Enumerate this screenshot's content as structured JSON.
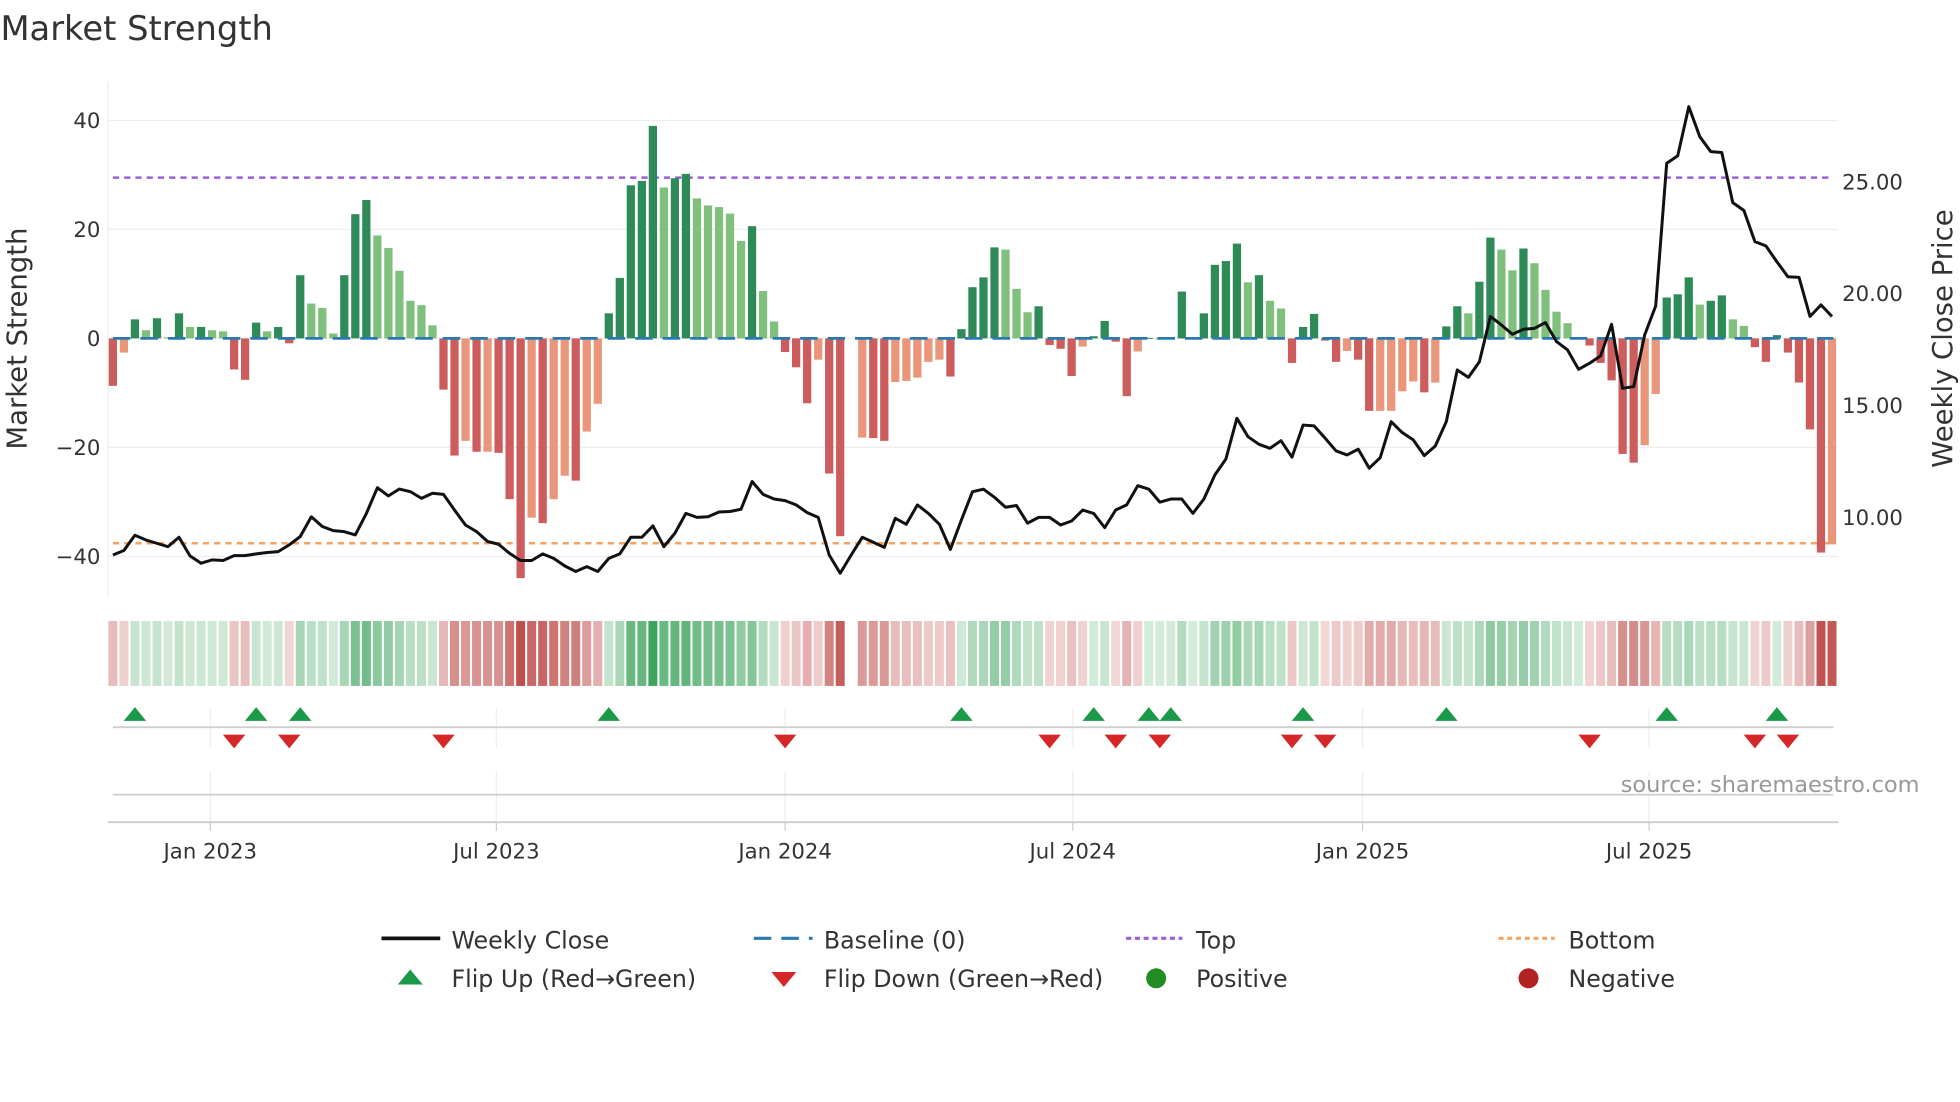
{
  "chart_data": {
    "type": "bar",
    "title": "Market Strength",
    "ylabel_left": "Market Strength",
    "ylabel_right": "Weekly Close Price",
    "ylim_left": [
      -47.5,
      47.2
    ],
    "ylim_right": [
      6.37,
      29.44
    ],
    "yticks_left": [
      {
        "v": 40,
        "label": "40"
      },
      {
        "v": 20,
        "label": "20"
      },
      {
        "v": 0,
        "label": "0"
      },
      {
        "v": -20,
        "label": "−20"
      },
      {
        "v": -40,
        "label": "−40"
      }
    ],
    "yticks_right": [
      {
        "v": 25,
        "label": "25.00"
      },
      {
        "v": 20,
        "label": "20.00"
      },
      {
        "v": 15,
        "label": "15.00"
      },
      {
        "v": 10,
        "label": "10.00"
      }
    ],
    "xticks": [
      {
        "week": 8.84,
        "label": "Jan 2023"
      },
      {
        "week": 34.8,
        "label": "Jul 2023"
      },
      {
        "week": 61.0,
        "label": "Jan 2024"
      },
      {
        "week": 87.1,
        "label": "Jul 2024"
      },
      {
        "week": 113.4,
        "label": "Jan 2025"
      },
      {
        "week": 139.4,
        "label": "Jul 2025"
      }
    ],
    "grid": true,
    "top_level": 29.5,
    "bottom_level": -37.6,
    "baseline": 0,
    "strength": [
      -8.7,
      -2.6,
      3.5,
      1.5,
      3.7,
      0.2,
      4.6,
      2.1,
      2.1,
      1.5,
      1.3,
      -5.7,
      -7.6,
      2.9,
      1.3,
      2.1,
      -0.9,
      11.6,
      6.4,
      5.6,
      0.9,
      11.6,
      22.8,
      25.4,
      18.9,
      16.6,
      12.4,
      6.9,
      6.1,
      2.4,
      -9.4,
      -21.5,
      -18.8,
      -20.8,
      -20.8,
      -21,
      -29.5,
      -44,
      -32.9,
      -33.9,
      -29.5,
      -25.2,
      -26.1,
      -17.1,
      -12,
      4.6,
      11.1,
      28.1,
      28.9,
      39,
      27.7,
      29.4,
      30.2,
      25.7,
      24.4,
      24.1,
      22.9,
      17.9,
      20.6,
      8.7,
      3.1,
      -2.5,
      -5.3,
      -11.9,
      -3.9,
      -24.8,
      -36.3,
      null,
      -18.2,
      -18.3,
      -18.8,
      -8,
      -7.8,
      -7.2,
      -4.3,
      -3.9,
      -7,
      1.7,
      9.4,
      11.2,
      16.7,
      16.3,
      9.1,
      4.8,
      5.9,
      -1.2,
      -1.9,
      -6.9,
      -1.5,
      0.4,
      3.2,
      -0.6,
      -10.6,
      -2.4,
      0.1,
      0,
      0.2,
      8.6,
      0,
      4.6,
      13.5,
      14.2,
      17.4,
      10.3,
      11.6,
      6.9,
      5.5,
      -4.5,
      2.1,
      4.5,
      -0.4,
      -4.3,
      -2.3,
      -3.9,
      -13.3,
      -13.3,
      -13.3,
      -9.7,
      -7.9,
      -9.9,
      -8.1,
      2.2,
      5.9,
      4.6,
      10.4,
      18.5,
      16.3,
      12.5,
      16.5,
      13.8,
      8.9,
      4.9,
      2.8,
      0.1,
      -1.3,
      -4.5,
      -7.7,
      -21.2,
      -22.8,
      -19.6,
      -10.2,
      7.5,
      8.1,
      11.2,
      6.2,
      6.9,
      7.9,
      3.5,
      2.3,
      -1.6,
      -4.3,
      0.6,
      -2.6,
      -8.1,
      -16.7,
      -39.3,
      -37.8
    ],
    "weekly_close": [
      8.26,
      8.46,
      9.14,
      8.93,
      8.78,
      8.63,
      9.05,
      8.22,
      7.89,
      8.04,
      8.01,
      8.23,
      8.23,
      8.31,
      8.37,
      8.41,
      8.71,
      9.08,
      9.97,
      9.53,
      9.35,
      9.3,
      9.16,
      10.12,
      11.27,
      10.9,
      11.21,
      11.09,
      10.79,
      11.02,
      10.97,
      10.27,
      9.6,
      9.3,
      8.86,
      8.74,
      8.33,
      8.01,
      8.01,
      8.31,
      8.11,
      7.77,
      7.52,
      7.74,
      7.52,
      8.11,
      8.31,
      9.05,
      9.05,
      9.56,
      8.63,
      9.23,
      10.12,
      9.94,
      9.97,
      10.18,
      10.2,
      10.3,
      11.54,
      10.97,
      10.76,
      10.69,
      10.5,
      10.15,
      9.94,
      8.26,
      7.44,
      8.26,
      9.05,
      8.83,
      8.6,
      9.9,
      9.63,
      10.5,
      10.12,
      9.63,
      8.51,
      9.82,
      11.09,
      11.2,
      10.84,
      10.39,
      10.47,
      9.68,
      9.94,
      9.94,
      9.6,
      9.78,
      10.27,
      10.12,
      9.48,
      10.27,
      10.5,
      11.36,
      11.2,
      10.62,
      10.76,
      10.76,
      10.12,
      10.76,
      11.84,
      12.55,
      14.37,
      13.55,
      13.21,
      13.03,
      13.37,
      12.63,
      14.07,
      14.03,
      13.48,
      12.91,
      12.73,
      12.99,
      12.14,
      12.61,
      14.22,
      13.73,
      13.4,
      12.7,
      13.13,
      14.22,
      16.53,
      16.2,
      16.9,
      18.92,
      18.54,
      18.13,
      18.35,
      18.39,
      18.65,
      17.8,
      17.43,
      16.56,
      16.83,
      17.16,
      18.57,
      15.71,
      15.79,
      18.1,
      19.39,
      25.77,
      26.1,
      28.3,
      26.96,
      26.29,
      26.25,
      24.01,
      23.66,
      22.27,
      22.08,
      21.37,
      20.7,
      20.67,
      18.92,
      19.44,
      18.92
    ],
    "flip_up_weeks": [
      2,
      13,
      17,
      45,
      77,
      89,
      94,
      96,
      108,
      121,
      141,
      151
    ],
    "flip_down_weeks": [
      11,
      16,
      30,
      61,
      85,
      91,
      95,
      107,
      110,
      134,
      149,
      152
    ],
    "legend": {
      "placement": "bottom",
      "items": [
        {
          "key": "close",
          "label": "Weekly Close"
        },
        {
          "key": "baseline",
          "label": "Baseline (0)"
        },
        {
          "key": "top",
          "label": "Top"
        },
        {
          "key": "bottom",
          "label": "Bottom"
        },
        {
          "key": "flipup",
          "label": "Flip Up (Red→Green)"
        },
        {
          "key": "flipdown",
          "label": "Flip Down (Green→Red)"
        },
        {
          "key": "positive",
          "label": "Positive"
        },
        {
          "key": "negative",
          "label": "Negative"
        }
      ]
    },
    "annotation": "source: sharemaestro.com",
    "colors": {
      "pos_rising": "#2e8b57",
      "pos_falling": "#80c07d",
      "neg_falling": "#cd5c5c",
      "neg_rising": "#e9967a",
      "close": "#111111",
      "baseline": "#2a7ab0",
      "top": "#9b5fd6",
      "bottom": "#f4a460",
      "flipup": "#1a9a48",
      "flipdown": "#d62728",
      "positive": "#228b22",
      "negative": "#b22222",
      "strip_pos": "#3aa35a",
      "strip_neg": "#c0504d"
    }
  }
}
